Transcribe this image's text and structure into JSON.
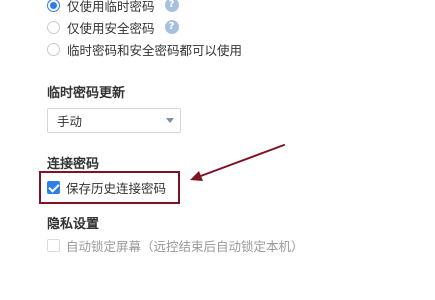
{
  "password_mode": {
    "options": [
      {
        "label": "仅使用临时密码",
        "checked": true,
        "has_help": true
      },
      {
        "label": "仅使用安全密码",
        "checked": false,
        "has_help": true
      },
      {
        "label": "临时密码和安全密码都可以使用",
        "checked": false,
        "has_help": false
      }
    ],
    "help_glyph": "?"
  },
  "temp_password_update": {
    "title": "临时密码更新",
    "select_value": "手动"
  },
  "connection_password": {
    "title": "连接密码",
    "save_history_label": "保存历史连接密码",
    "save_history_checked": true
  },
  "privacy": {
    "title": "隐私设置",
    "auto_lock_label": "自动锁定屏幕（远控结束后自动锁定本机）",
    "auto_lock_checked": false
  },
  "colors": {
    "accent": "#2f7ee8",
    "annotation": "#7c1426",
    "help_icon": "#a9bfe0"
  }
}
